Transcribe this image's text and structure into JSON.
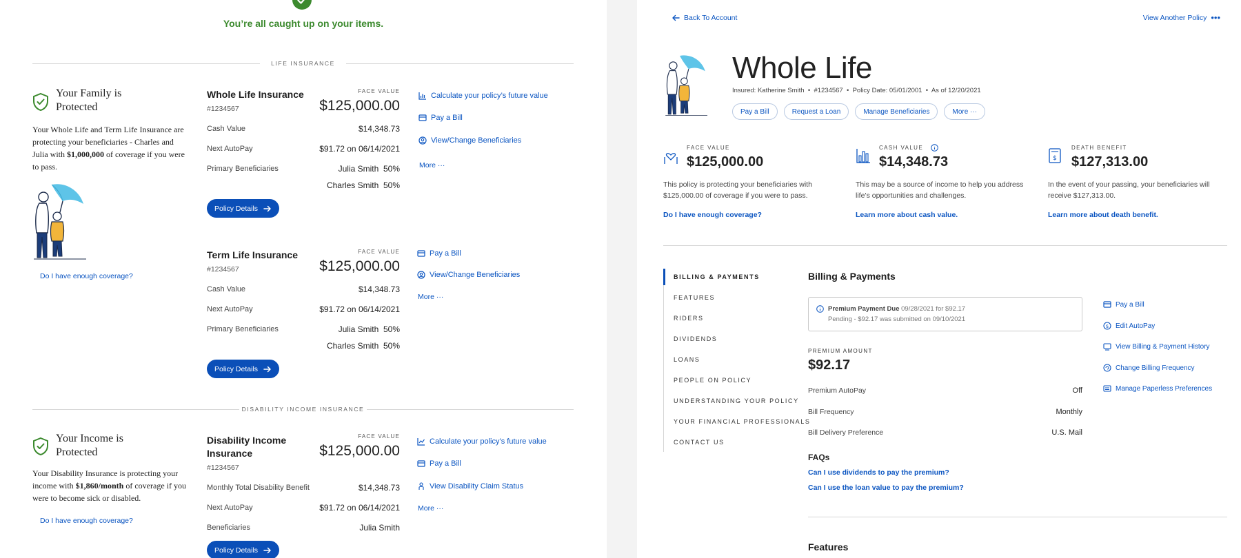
{
  "left": {
    "caught_up": "You’re all caught up on your items.",
    "life_section_label": "LIFE INSURANCE",
    "disability_section_label": "DISABILITY INCOME INSURANCE",
    "family_card": {
      "title": "Your Family is Protected",
      "desc_pre": "Your Whole Life and Term Life Insurance are protecting your beneficiaries - Charles and Julia with ",
      "desc_bold": "$1,000,000",
      "desc_post": " of coverage if you were to pass.",
      "coverage_link": "Do I have enough coverage?"
    },
    "income_card": {
      "title": "Your Income is Protected",
      "desc_pre": "Your Disability Insurance is protecting your income with ",
      "desc_bold": "$1,860/month",
      "desc_post": " of coverage if you were to become sick or disabled.",
      "coverage_link": "Do I have enough coverage?"
    },
    "whole_life": {
      "name": "Whole Life Insurance",
      "number": "#1234567",
      "face_label": "FACE VALUE",
      "face_value": "$125,000.00",
      "rows": [
        {
          "label": "Cash Value",
          "value": "$14,348.73"
        },
        {
          "label": "Next AutoPay",
          "value": "$91.72 on 06/14/2021"
        },
        {
          "label": "Primary Beneficiaries",
          "value": "Julia Smith  50%"
        },
        {
          "label": "",
          "value": "Charles Smith  50%"
        }
      ],
      "button": "Policy Details",
      "actions": [
        "Calculate your policy’s future value",
        "Pay a Bill",
        "View/Change Beneficiaries",
        "More ···"
      ]
    },
    "term_life": {
      "name": "Term Life Insurance",
      "number": "#1234567",
      "face_label": "FACE VALUE",
      "face_value": "$125,000.00",
      "rows": [
        {
          "label": "Cash Value",
          "value": "$14,348.73"
        },
        {
          "label": "Next AutoPay",
          "value": "$91.72 on 06/14/2021"
        },
        {
          "label": "Primary Beneficiaries",
          "value": "Julia Smith  50%"
        },
        {
          "label": "",
          "value": "Charles Smith  50%"
        }
      ],
      "button": "Policy Details",
      "actions": [
        "Pay a Bill",
        "View/Change Beneficiaries",
        "More ···"
      ]
    },
    "disability": {
      "name_line1": "Disability Income",
      "name_line2": "Insurance",
      "number": "#1234567",
      "face_label": "FACE VALUE",
      "face_value": "$125,000.00",
      "rows": [
        {
          "label": "Monthly Total Disability Benefit",
          "value": "$14,348.73"
        },
        {
          "label": "Next AutoPay",
          "value": "$91.72 on 06/14/2021"
        },
        {
          "label": "Beneficiaries",
          "value": "Julia Smith"
        }
      ],
      "button": "Policy Details",
      "actions": [
        "Calculate your policy’s future value",
        "Pay a Bill",
        "View Disability Claim Status",
        "More ···"
      ]
    }
  },
  "right": {
    "back_link": "Back To Account",
    "view_another": "View Another Policy",
    "title": "Whole Life",
    "meta": "Insured: Katherine Smith  •  #1234567  •  Policy Date: 05/01/2001  •  As of 12/20/2021",
    "pills": [
      "Pay a Bill",
      "Request a Loan",
      "Manage Beneficiaries",
      "More ···"
    ],
    "stats": [
      {
        "label": "FACE VALUE",
        "value": "$125,000.00",
        "desc": "This policy is protecting your beneficiaries with $125,000.00 of coverage if you were to pass.",
        "link": "Do I have enough coverage?"
      },
      {
        "label": "CASH VALUE",
        "value": "$14,348.73",
        "desc": "This may be a source of income to help you address life’s opportunities and challenges.",
        "link": "Learn more about cash value."
      },
      {
        "label": "DEATH BENEFIT",
        "value": "$127,313.00",
        "desc": "In the event of your passing, your beneficiaries will receive $127,313.00.",
        "link": "Learn more about death benefit."
      }
    ],
    "nav": [
      "BILLING & PAYMENTS",
      "FEATURES",
      "RIDERS",
      "DIVIDENDS",
      "LOANS",
      "PEOPLE ON POLICY",
      "UNDERSTANDING YOUR POLICY",
      "YOUR FINANCIAL PROFESSIONALS",
      "CONTACT US"
    ],
    "billing": {
      "title": "Billing & Payments",
      "notice_bold": "Premium Payment Due",
      "notice_rest": " 09/28/2021 for $92.17",
      "notice_line2": "Pending - $92.17 was submitted on 09/10/2021",
      "premium_label": "PREMIUM AMOUNT",
      "premium_value": "$92.17",
      "rows": [
        {
          "label": "Premium AutoPay",
          "value": "Off"
        },
        {
          "label": "Bill Frequency",
          "value": "Monthly"
        },
        {
          "label": "Bill Delivery Preference",
          "value": "U.S. Mail"
        }
      ],
      "actions": [
        "Pay a Bill",
        "Edit AutoPay",
        "View Billing & Payment History",
        "Change Billing Frequency",
        "Manage Paperless Preferences"
      ],
      "faqs_title": "FAQs",
      "faqs": [
        "Can I use dividends to pay the premium?",
        "Can I use the loan value to pay the premium?"
      ]
    },
    "features_title": "Features"
  },
  "colors": {
    "accent": "#0b55c1",
    "button": "#0b4fb8",
    "success": "#3c8a2e"
  }
}
